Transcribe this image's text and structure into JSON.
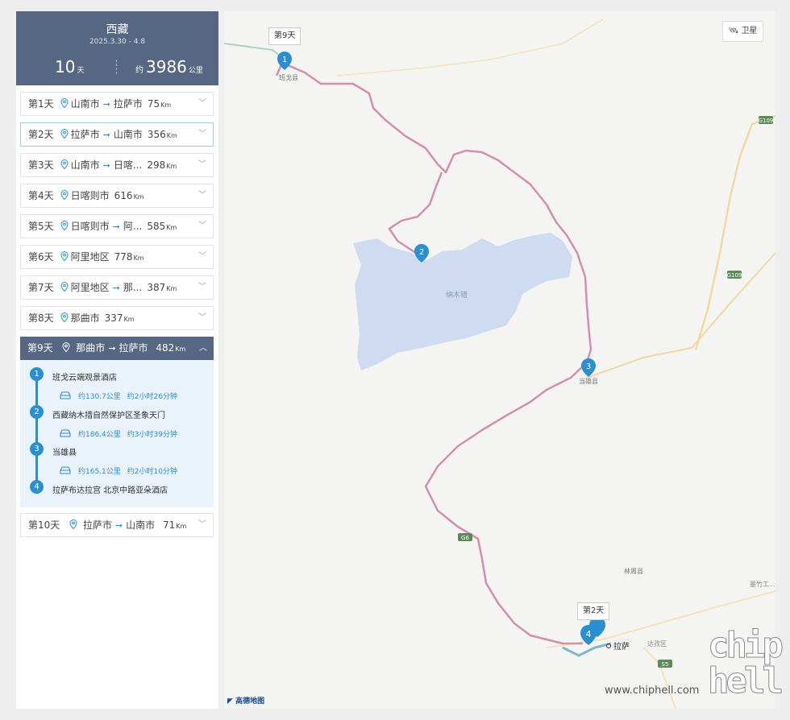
{
  "trip": {
    "title": "西藏",
    "dates": "2025.3.30 - 4.8",
    "days_value": "10",
    "days_unit": "天",
    "dist_prefix": "约",
    "dist_value": "3986",
    "dist_unit": "公里"
  },
  "days": [
    {
      "label": "第1天",
      "from": "山南市",
      "to": "拉萨市",
      "km": "75"
    },
    {
      "label": "第2天",
      "from": "拉萨市",
      "to": "山南市",
      "km": "356"
    },
    {
      "label": "第3天",
      "from": "山南市",
      "to": "日喀...",
      "km": "298"
    },
    {
      "label": "第4天",
      "from": "日喀则市",
      "to": "",
      "km": "616"
    },
    {
      "label": "第5天",
      "from": "日喀则市",
      "to": "阿...",
      "km": "585"
    },
    {
      "label": "第6天",
      "from": "阿里地区",
      "to": "",
      "km": "778"
    },
    {
      "label": "第7天",
      "from": "阿里地区",
      "to": "那...",
      "km": "387"
    },
    {
      "label": "第8天",
      "from": "那曲市",
      "to": "",
      "km": "337"
    }
  ],
  "day9": {
    "label": "第9天",
    "from": "那曲市",
    "to": "拉萨市",
    "km": "482",
    "stops": [
      "班戈云端观景酒店",
      "西藏纳木措自然保护区圣象天门",
      "当雄县",
      "拉萨布达拉宫 北京中路亚朵酒店"
    ],
    "stop_numbers": [
      "1",
      "2",
      "3",
      "4"
    ],
    "segments": [
      {
        "dist": "约130.7公里",
        "time": "约2小时26分钟"
      },
      {
        "dist": "约186.4公里",
        "time": "约3小时39分钟"
      },
      {
        "dist": "约165.1公里",
        "time": "约2小时10分钟"
      }
    ]
  },
  "day10": {
    "label": "第10天",
    "from": "拉萨市",
    "to": "山南市",
    "km": "71"
  },
  "km_unit": "Km",
  "map": {
    "satellite_label": "卫星",
    "callout_day9": "第9天",
    "callout_day2": "第2天",
    "marker_numbers": [
      "1",
      "2",
      "3",
      "4"
    ],
    "labels": {
      "bange": "班戈县",
      "namtso": "纳木错",
      "damxung": "当雄县",
      "lhasa": "拉萨",
      "linzhou": "林周县",
      "dazi": "达孜区",
      "mozhu": "墨竹工..."
    },
    "road_labels": [
      "G109",
      "G109",
      "G6",
      "G6",
      "S5"
    ],
    "logo": "高德地图",
    "route_color": "#d48fb0",
    "water_color": "#cfdbf0"
  },
  "watermark": {
    "url": "www.chiphell.com",
    "logo": "chip hell"
  }
}
